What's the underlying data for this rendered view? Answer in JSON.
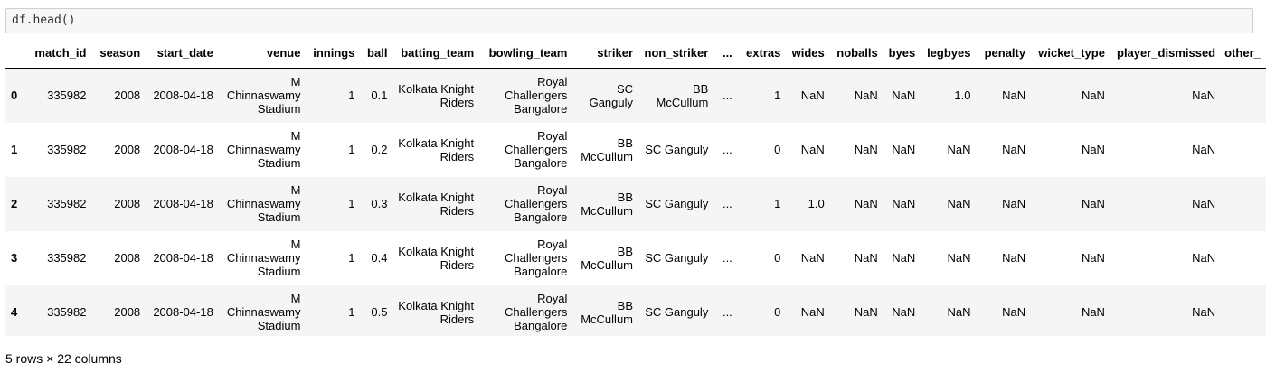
{
  "code_cell": {
    "source": "df.head()"
  },
  "dataframe": {
    "columns": [
      "match_id",
      "season",
      "start_date",
      "venue",
      "innings",
      "ball",
      "batting_team",
      "bowling_team",
      "striker",
      "non_striker",
      "...",
      "extras",
      "wides",
      "noballs",
      "byes",
      "legbyes",
      "penalty",
      "wicket_type",
      "player_dismissed",
      "other_"
    ],
    "rows": [
      {
        "index": "0",
        "cells": [
          "335982",
          "2008",
          "2008-04-18",
          "M Chinnaswamy Stadium",
          "1",
          "0.1",
          "Kolkata Knight Riders",
          "Royal Challengers Bangalore",
          "SC Ganguly",
          "BB McCullum",
          "...",
          "1",
          "NaN",
          "NaN",
          "NaN",
          "1.0",
          "NaN",
          "NaN",
          "NaN",
          ""
        ]
      },
      {
        "index": "1",
        "cells": [
          "335982",
          "2008",
          "2008-04-18",
          "M Chinnaswamy Stadium",
          "1",
          "0.2",
          "Kolkata Knight Riders",
          "Royal Challengers Bangalore",
          "BB McCullum",
          "SC Ganguly",
          "...",
          "0",
          "NaN",
          "NaN",
          "NaN",
          "NaN",
          "NaN",
          "NaN",
          "NaN",
          ""
        ]
      },
      {
        "index": "2",
        "cells": [
          "335982",
          "2008",
          "2008-04-18",
          "M Chinnaswamy Stadium",
          "1",
          "0.3",
          "Kolkata Knight Riders",
          "Royal Challengers Bangalore",
          "BB McCullum",
          "SC Ganguly",
          "...",
          "1",
          "1.0",
          "NaN",
          "NaN",
          "NaN",
          "NaN",
          "NaN",
          "NaN",
          ""
        ]
      },
      {
        "index": "3",
        "cells": [
          "335982",
          "2008",
          "2008-04-18",
          "M Chinnaswamy Stadium",
          "1",
          "0.4",
          "Kolkata Knight Riders",
          "Royal Challengers Bangalore",
          "BB McCullum",
          "SC Ganguly",
          "...",
          "0",
          "NaN",
          "NaN",
          "NaN",
          "NaN",
          "NaN",
          "NaN",
          "NaN",
          ""
        ]
      },
      {
        "index": "4",
        "cells": [
          "335982",
          "2008",
          "2008-04-18",
          "M Chinnaswamy Stadium",
          "1",
          "0.5",
          "Kolkata Knight Riders",
          "Royal Challengers Bangalore",
          "BB McCullum",
          "SC Ganguly",
          "...",
          "0",
          "NaN",
          "NaN",
          "NaN",
          "NaN",
          "NaN",
          "NaN",
          "NaN",
          ""
        ]
      }
    ],
    "shape_text": "5 rows × 22 columns"
  }
}
